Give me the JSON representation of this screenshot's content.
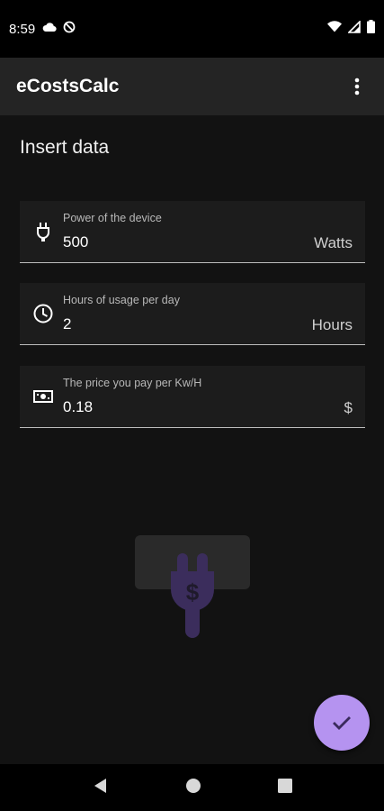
{
  "status_bar": {
    "time": "8:59",
    "left_icons": [
      "cloud-icon",
      "no-sync-icon"
    ],
    "right_icons": [
      "wifi-icon",
      "signal-icon",
      "battery-icon"
    ]
  },
  "app_bar": {
    "title": "eCostsCalc",
    "menu_icon": "more-vert-icon"
  },
  "main": {
    "section_title": "Insert data",
    "fields": [
      {
        "icon": "plug-icon",
        "label": "Power of the device",
        "value": "500",
        "suffix": "Watts"
      },
      {
        "icon": "clock-icon",
        "label": "Hours of usage per day",
        "value": "2",
        "suffix": "Hours"
      },
      {
        "icon": "money-icon",
        "label": "The price you pay per Kw/H",
        "value": "0.18",
        "suffix": "$"
      }
    ],
    "illustration_icon": "plug-dollar-icon"
  },
  "fab": {
    "icon": "check-icon",
    "color": "#b593f0"
  },
  "nav_bar": {
    "icons": [
      "back-icon",
      "home-icon",
      "recents-icon"
    ]
  }
}
